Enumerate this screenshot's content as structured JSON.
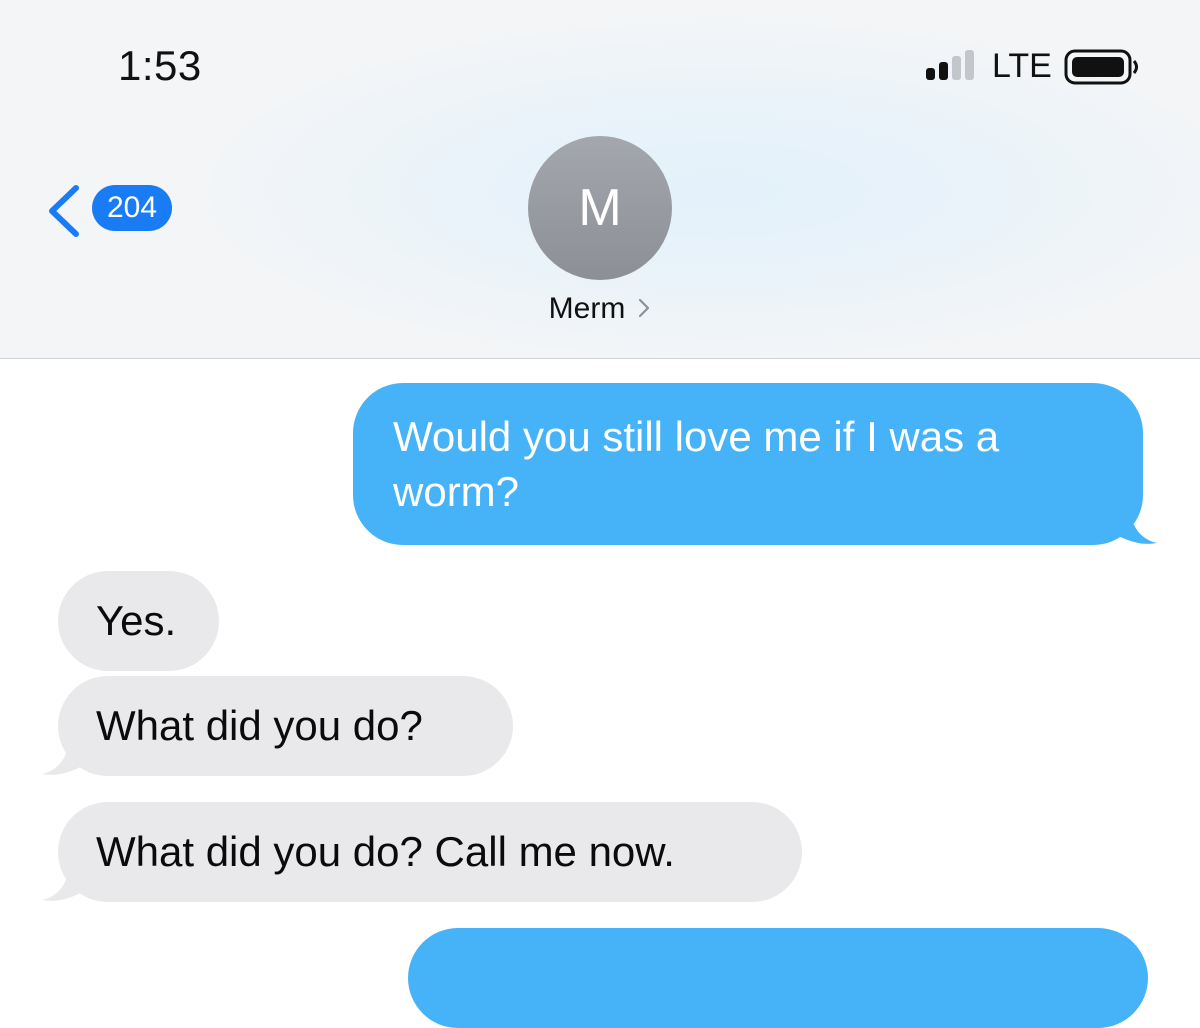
{
  "status_bar": {
    "time": "1:53",
    "network": "LTE",
    "signal_bars_filled": 2,
    "signal_bars_total": 4,
    "icons": [
      "cellular-signal-icon",
      "battery-icon"
    ]
  },
  "nav": {
    "back_badge": "204",
    "back_icon": "chevron-left-icon"
  },
  "contact": {
    "initial": "M",
    "name": "Merm",
    "name_icon": "chevron-right-icon"
  },
  "messages": [
    {
      "direction": "sent",
      "text": "Would you still love me if I was a worm?"
    },
    {
      "direction": "received",
      "text": "Yes."
    },
    {
      "direction": "received",
      "text": "What did you do?"
    },
    {
      "direction": "received",
      "text": "What did you do? Call me now."
    },
    {
      "direction": "sent",
      "text": ""
    }
  ],
  "colors": {
    "sent_bubble": "#46b3f8",
    "received_bubble": "#e9e9eb",
    "badge": "#1a7cf5",
    "back_chevron": "#1a7cf5",
    "avatar": "#9a9da4"
  }
}
